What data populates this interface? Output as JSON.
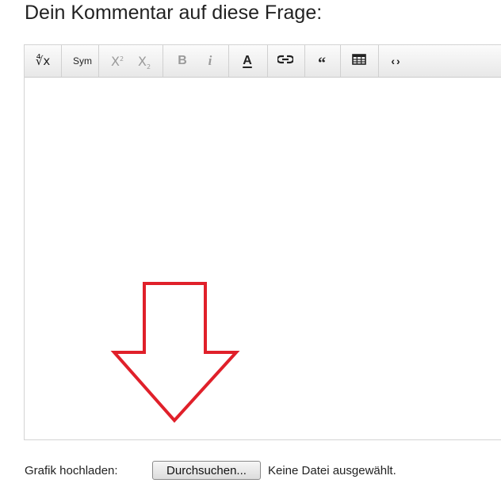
{
  "heading": "Dein Kommentar auf diese Frage:",
  "toolbar": {
    "items": [
      {
        "label": "∜x",
        "icon": "math-root-icon"
      },
      {
        "label": "Sym",
        "icon": "symbol-icon"
      },
      {
        "label": "X",
        "icon": "superscript-icon"
      },
      {
        "label": "X",
        "icon": "subscript-icon"
      },
      {
        "label": "B",
        "icon": "bold-icon"
      },
      {
        "label": "i",
        "icon": "italic-icon"
      },
      {
        "label": "A",
        "icon": "text-color-icon"
      },
      {
        "label": "",
        "icon": "link-icon"
      },
      {
        "label": "“",
        "icon": "blockquote-icon"
      },
      {
        "label": "",
        "icon": "table-icon"
      },
      {
        "label": "‹›",
        "icon": "code-icon"
      }
    ],
    "superscript_mark": "2",
    "subscript_mark": "2"
  },
  "annotation": {
    "icon": "down-arrow-icon",
    "color": "#e0202a"
  },
  "upload": {
    "label": "Grafik hochladen:",
    "button_label": "Durchsuchen...",
    "status": "Keine Datei ausgewählt."
  }
}
